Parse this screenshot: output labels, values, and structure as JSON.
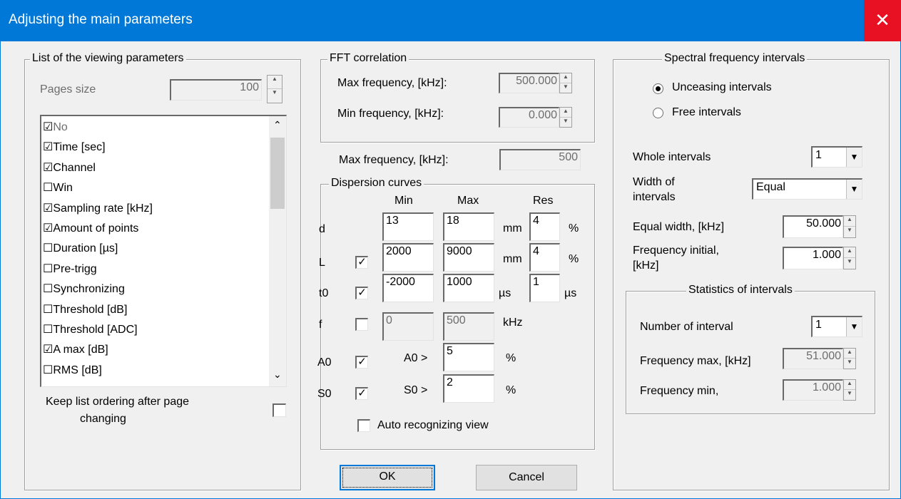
{
  "window": {
    "title": "Adjusting the main parameters",
    "close_glyph": "✕"
  },
  "viewing": {
    "legend": "List of the viewing parameters",
    "pages_size_label": "Pages size",
    "pages_size_value": "100",
    "items": [
      {
        "label": "No",
        "checked": true,
        "disabled": true
      },
      {
        "label": "Time [sec]",
        "checked": true
      },
      {
        "label": "Channel",
        "checked": true
      },
      {
        "label": "Win",
        "checked": false
      },
      {
        "label": "Sampling rate [kHz]",
        "checked": true
      },
      {
        "label": "Amount of points",
        "checked": true
      },
      {
        "label": "Duration [µs]",
        "checked": false
      },
      {
        "label": "Pre-trigg",
        "checked": false
      },
      {
        "label": "Synchronizing",
        "checked": false
      },
      {
        "label": "Threshold [dB]",
        "checked": false
      },
      {
        "label": "Threshold [ADC]",
        "checked": false
      },
      {
        "label": "A max [dB]",
        "checked": true
      },
      {
        "label": "RMS [dB]",
        "checked": false
      }
    ],
    "scroll_up": "⌃",
    "scroll_down": "⌄",
    "keep_order_label_1": "Keep list ordering after page",
    "keep_order_label_2": "changing"
  },
  "fft": {
    "legend": "FFT correlation",
    "max_label": "Max frequency, [kHz]:",
    "max_value": "500.000",
    "min_label": "Min frequency, [kHz]:",
    "min_value": "0.000"
  },
  "max_freq_label": "Max frequency, [kHz]:",
  "max_freq_value": "500",
  "dispersion": {
    "legend": "Dispersion curves",
    "col_min": "Min",
    "col_max": "Max",
    "col_res": "Res",
    "d": {
      "label": "d",
      "min": "13",
      "max": "18",
      "unit": "mm",
      "res": "4",
      "res_unit": "%"
    },
    "L": {
      "label": "L",
      "checked": true,
      "min": "2000",
      "max": "9000",
      "unit": "mm",
      "res": "4",
      "res_unit": "%"
    },
    "t0": {
      "label": "t0",
      "checked": true,
      "min": "-2000",
      "max": "1000",
      "unit": "µs",
      "res": "1",
      "res_unit": "µs"
    },
    "f": {
      "label": "f",
      "checked": false,
      "min": "0",
      "max": "500",
      "unit": "kHz"
    },
    "A0": {
      "label": "A0",
      "checked": true,
      "cmp": "A0 >",
      "value": "5",
      "unit": "%"
    },
    "S0": {
      "label": "S0",
      "checked": true,
      "cmp": "S0 >",
      "value": "2",
      "unit": "%"
    },
    "auto_label": "Auto recognizing view"
  },
  "buttons": {
    "ok": "OK",
    "cancel": "Cancel"
  },
  "spectral": {
    "legend": "Spectral frequency intervals",
    "unceasing": "Unceasing intervals",
    "free": "Free intervals",
    "selected": "unceasing",
    "whole_label": "Whole intervals",
    "whole_value": "1",
    "width_label_1": "Width of",
    "width_label_2": "intervals",
    "width_value": "Equal",
    "equal_width_label": "Equal width, [kHz]",
    "equal_width_value": "50.000",
    "freq_initial_label_1": "Frequency initial,",
    "freq_initial_label_2": "[kHz]",
    "freq_initial_value": "1.000"
  },
  "stats": {
    "legend": "Statistics of intervals",
    "number_label": "Number of interval",
    "number_value": "1",
    "fmax_label": "Frequency max, [kHz]",
    "fmax_value": "51.000",
    "fmin_label": "Frequency min,",
    "fmin_value": "1.000"
  },
  "glyphs": {
    "check": "✓",
    "down": "▼",
    "spin_up": "▲",
    "spin_down": "▼"
  }
}
